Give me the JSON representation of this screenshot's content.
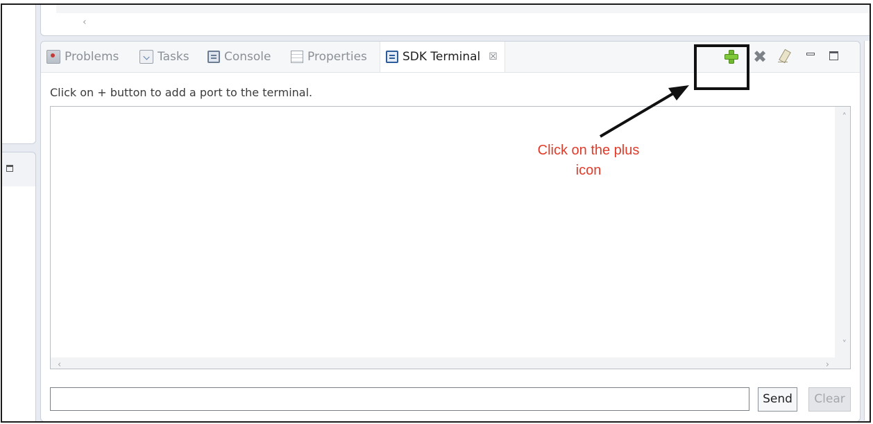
{
  "tabs": [
    {
      "label": "Problems",
      "icon": "problems-icon",
      "active": false
    },
    {
      "label": "Tasks",
      "icon": "tasks-icon",
      "active": false
    },
    {
      "label": "Console",
      "icon": "console-icon",
      "active": false
    },
    {
      "label": "Properties",
      "icon": "properties-icon",
      "active": false
    },
    {
      "label": "SDK Terminal",
      "icon": "sdk-terminal-icon",
      "active": true
    }
  ],
  "tab_close_glyph": "☒",
  "toolbar": {
    "add_port": "plus-icon",
    "remove_port": "remove-icon",
    "clear_console": "erase-icon",
    "minimize": "minimize-icon",
    "maximize": "maximize-icon",
    "remove_glyph": "✖"
  },
  "terminal": {
    "hint": "Click on + button to add a port to the terminal.",
    "output": ""
  },
  "input": {
    "value": "",
    "placeholder": ""
  },
  "buttons": {
    "send": "Send",
    "clear": "Clear"
  },
  "scroll_glyphs": {
    "left": "‹",
    "right": "›",
    "up": "˄",
    "down": "˅"
  },
  "annotation": {
    "text_line1": "Click on the plus",
    "text_line2": "icon",
    "color": "#e03b2a"
  }
}
